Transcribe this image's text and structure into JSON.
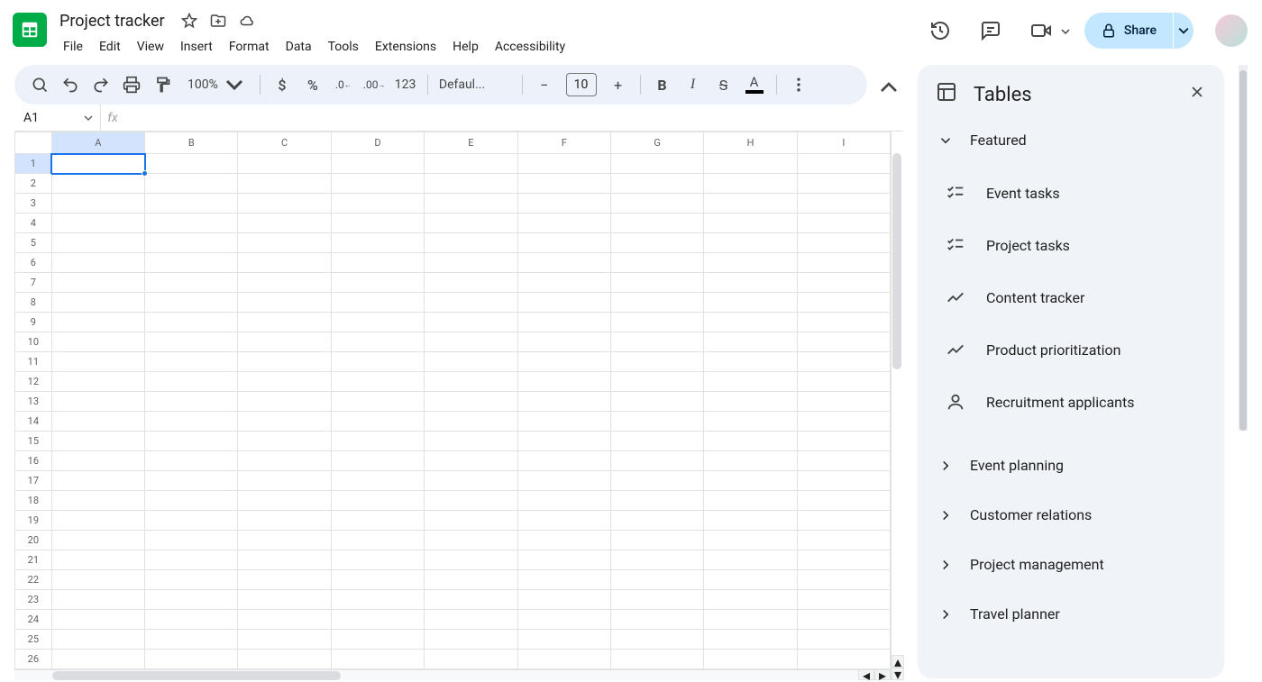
{
  "header": {
    "doc_title": "Project tracker",
    "menus": [
      "File",
      "Edit",
      "View",
      "Insert",
      "Format",
      "Data",
      "Tools",
      "Extensions",
      "Help",
      "Accessibility"
    ],
    "share_label": "Share"
  },
  "toolbar": {
    "zoom": "100%",
    "font": "Defaul...",
    "font_size": "10",
    "number_fmt": "123"
  },
  "formula_bar": {
    "name_box": "A1"
  },
  "grid": {
    "columns": [
      "A",
      "B",
      "C",
      "D",
      "E",
      "F",
      "G",
      "H",
      "I"
    ],
    "rows": 26,
    "selected": "A1"
  },
  "side_panel": {
    "title": "Tables",
    "featured_label": "Featured",
    "templates": [
      {
        "icon": "checklist",
        "label": "Event tasks"
      },
      {
        "icon": "checklist",
        "label": "Project tasks"
      },
      {
        "icon": "trend",
        "label": "Content tracker"
      },
      {
        "icon": "trend",
        "label": "Product prioritization"
      },
      {
        "icon": "person",
        "label": "Recruitment applicants"
      }
    ],
    "collapsed_sections": [
      "Event planning",
      "Customer relations",
      "Project management",
      "Travel planner"
    ]
  }
}
